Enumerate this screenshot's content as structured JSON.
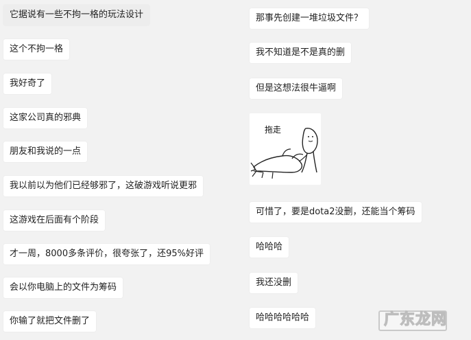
{
  "left_messages": [
    "它据说有一些不拘一格的玩法设计",
    "这个不拘一格",
    "我好奇了",
    "这家公司真的邪典",
    "朋友和我说的一点",
    "我以前以为他们已经够邪了，这破游戏听说更邪",
    "这游戏在后面有个阶段",
    "才一周，8000多条评价，很夸张了，还95%好评",
    "会以你电脑上的文件为筹码",
    "你输了就把文件删了"
  ],
  "right_messages": [
    "那事先创建一堆垃圾文件？",
    "我不知道是不是真的删",
    "但是这想法很牛逼啊",
    "可惜了，要是dota2没删，还能当个筹码",
    "哈哈哈",
    "我还没删",
    "哈哈哈哈哈哈"
  ],
  "sticker": {
    "caption": "拖走",
    "icon": "dragging-away-sticker-icon"
  },
  "watermark": {
    "text": "广东龙网"
  },
  "colors": {
    "background": "#f2f2f2",
    "bubble": "#ffffff",
    "bubble_highlight": "#ededed",
    "text": "#1f1f1f"
  }
}
